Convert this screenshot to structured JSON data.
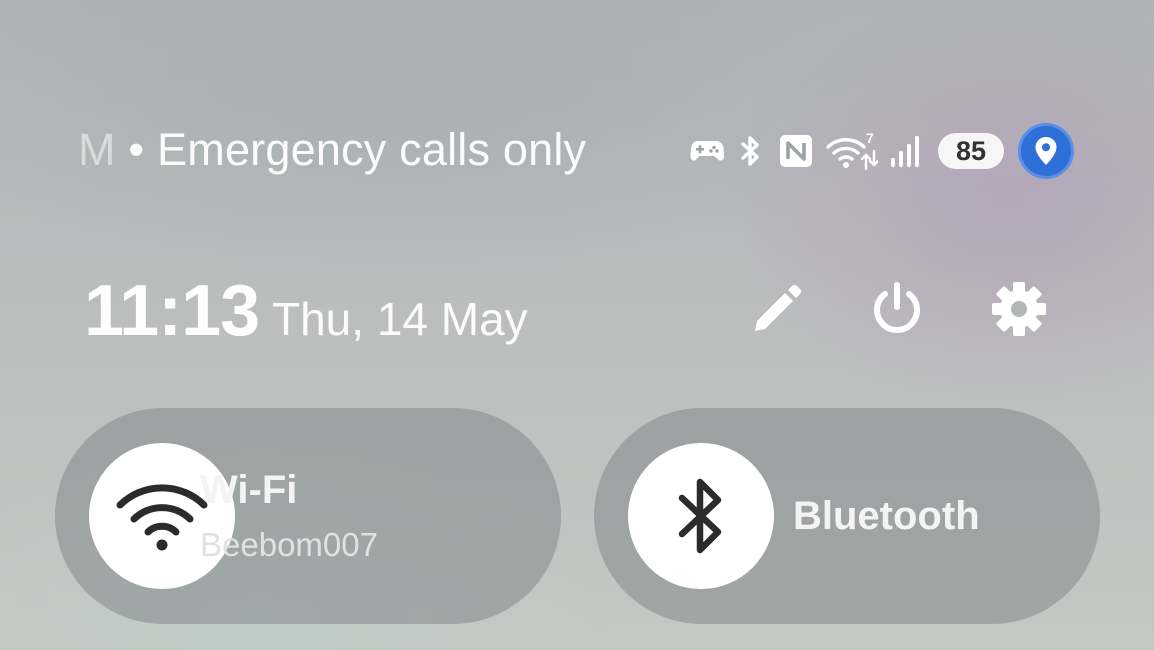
{
  "status_bar": {
    "carrier_fragment": "M",
    "carrier_text": "• Emergency calls only",
    "icons": [
      "game-controller-icon",
      "bluetooth-icon",
      "nfc-icon",
      "wifi-7-icon",
      "cellular-signal-icon"
    ],
    "battery_level": "85",
    "location_active": true
  },
  "header": {
    "time": "11:13",
    "date": "Thu, 14 May",
    "buttons": [
      "edit-icon",
      "power-icon",
      "settings-icon"
    ]
  },
  "tiles": {
    "wifi": {
      "title": "Wi-Fi",
      "subtitle": "Beebom007",
      "active": true
    },
    "bluetooth": {
      "title": "Bluetooth",
      "active": false
    }
  },
  "colors": {
    "location_badge": "#2f6fd8",
    "tile_background": "#8c9092",
    "icon_circle": "#ffffff",
    "icon_dark": "#2b2b2b"
  }
}
